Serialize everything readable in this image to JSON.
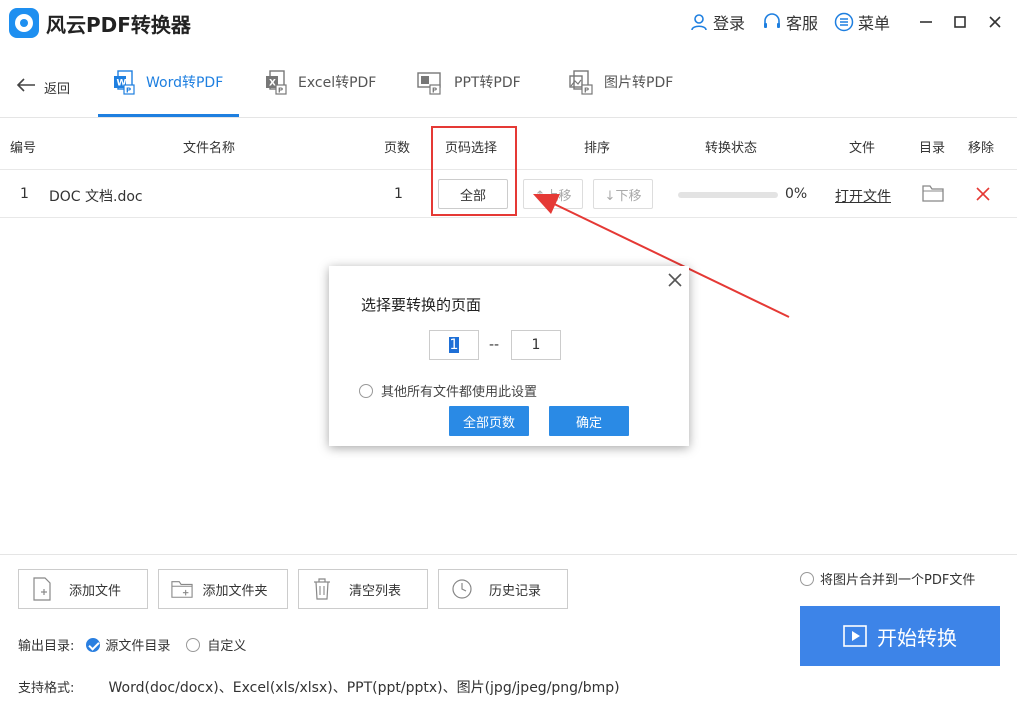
{
  "app": {
    "title": "风云PDF转换器"
  },
  "titlebar": {
    "login": "登录",
    "service": "客服",
    "menu": "菜单"
  },
  "nav": {
    "back": "返回",
    "tabs": [
      {
        "label": "Word转PDF"
      },
      {
        "label": "Excel转PDF"
      },
      {
        "label": "PPT转PDF"
      },
      {
        "label": "图片转PDF"
      }
    ]
  },
  "table": {
    "headers": {
      "index": "编号",
      "name": "文件名称",
      "pages": "页数",
      "page_select": "页码选择",
      "order": "排序",
      "status": "转换状态",
      "file": "文件",
      "dir": "目录",
      "remove": "移除"
    },
    "rows": [
      {
        "index": "1",
        "name": "DOC 文档.doc",
        "pages": "1",
        "page_select": "全部",
        "up": "↑上移",
        "down": "↓下移",
        "progress_percent": 0,
        "progress_text": "0%",
        "open": "打开文件"
      }
    ]
  },
  "dialog": {
    "title": "选择要转换的页面",
    "from": "1",
    "dash": "--",
    "to": "1",
    "apply_all": "其他所有文件都使用此设置",
    "all_pages": "全部页数",
    "confirm": "确定"
  },
  "bottom": {
    "add_file": "添加文件",
    "add_folder": "添加文件夹",
    "clear_list": "清空列表",
    "history": "历史记录",
    "merge_images": "将图片合并到一个PDF文件",
    "start": "开始转换",
    "output_label": "输出目录:",
    "output_source": "源文件目录",
    "output_custom": "自定义",
    "formats_label": "支持格式:",
    "formats": "Word(doc/docx)、Excel(xls/xlsx)、PPT(ppt/pptx)、图片(jpg/jpeg/png/bmp)"
  },
  "colors": {
    "accent": "#1e7fe0",
    "start_button": "#3d84e8",
    "highlight": "#e53935"
  }
}
